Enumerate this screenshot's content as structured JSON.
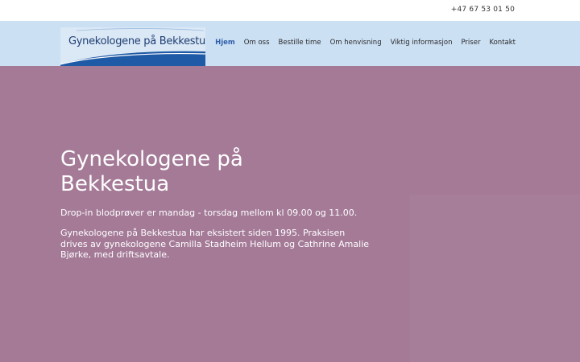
{
  "topbar": {
    "phone": "+47 67 53 01 50"
  },
  "logo": {
    "text": "Gynekologene på Bekkestua"
  },
  "menu": {
    "items": [
      {
        "label": "Hjem"
      },
      {
        "label": "Om oss"
      },
      {
        "label": "Bestille time"
      },
      {
        "label": "Om henvisning"
      },
      {
        "label": "Viktig informasjon"
      },
      {
        "label": "Priser"
      },
      {
        "label": "Kontakt"
      }
    ]
  },
  "hero": {
    "title": "Gynekologene på Bekkestua",
    "line1": "Drop-in blodprøver er mandag - torsdag mellom kl 09.00 og 11.00.",
    "paragraph": "Gynekologene på Bekkestua har eksistert siden 1995. Praksisen drives av gynekologene Camilla Stadheim Hellum og Cathrine Amalie Bjørke, med driftsavtale."
  },
  "colors": {
    "topbar_bg": "#ffffff",
    "nav_bg": "#cce0f4",
    "hero_bg": "#a47a97",
    "active_link": "#2f5fa8",
    "logo_blue": "#1f5aa6"
  }
}
